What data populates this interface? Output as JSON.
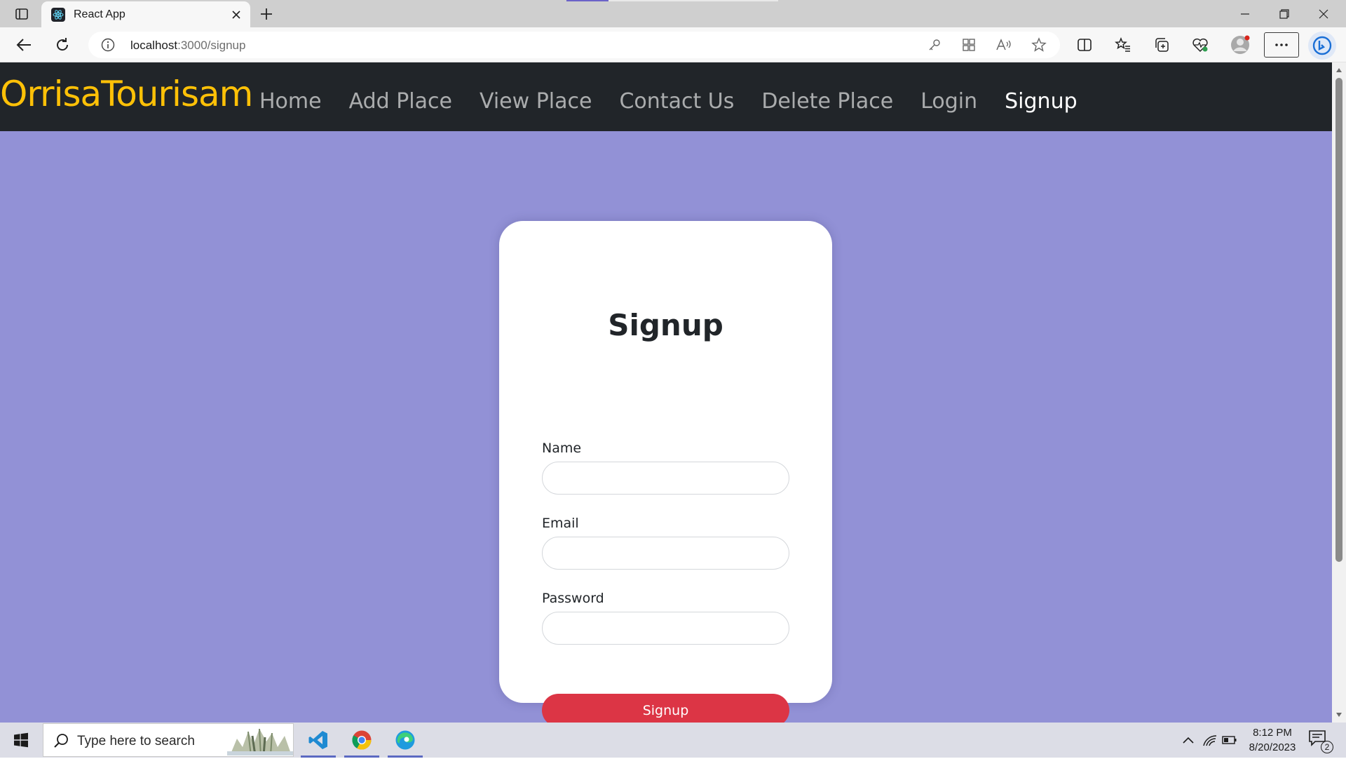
{
  "browser": {
    "tab_title": "React App",
    "url_host": "localhost",
    "url_path": ":3000/signup",
    "window_buttons": [
      "minimize",
      "restore",
      "close"
    ]
  },
  "navbar": {
    "brand": "OrrisaTourisam",
    "links": [
      "Home",
      "Add Place",
      "View Place",
      "Contact Us",
      "Delete Place",
      "Login",
      "Signup"
    ],
    "active_link": "Signup"
  },
  "form": {
    "title": "Signup",
    "fields": [
      {
        "label": "Name",
        "value": ""
      },
      {
        "label": "Email",
        "value": ""
      },
      {
        "label": "Password",
        "value": ""
      }
    ],
    "submit_label": "Signup"
  },
  "taskbar": {
    "search_placeholder": "Type here to search",
    "time": "8:12 PM",
    "date": "8/20/2023",
    "notification_count": "2",
    "pinned_apps": [
      "vscode-icon",
      "chrome-icon",
      "edge-icon"
    ]
  },
  "colors": {
    "page_background": "#9291d6",
    "navbar_background": "#212529",
    "brand": "#ffc107",
    "submit_button": "#dc3545"
  }
}
